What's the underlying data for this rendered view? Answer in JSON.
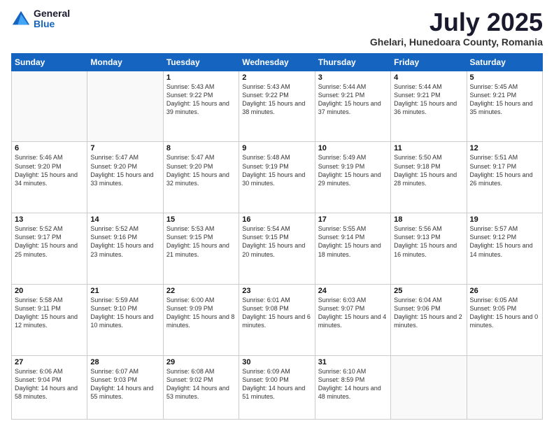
{
  "logo": {
    "general": "General",
    "blue": "Blue"
  },
  "title": "July 2025",
  "subtitle": "Ghelari, Hunedoara County, Romania",
  "weekdays": [
    "Sunday",
    "Monday",
    "Tuesday",
    "Wednesday",
    "Thursday",
    "Friday",
    "Saturday"
  ],
  "weeks": [
    [
      {
        "day": "",
        "sunrise": "",
        "sunset": "",
        "daylight": ""
      },
      {
        "day": "",
        "sunrise": "",
        "sunset": "",
        "daylight": ""
      },
      {
        "day": "1",
        "sunrise": "Sunrise: 5:43 AM",
        "sunset": "Sunset: 9:22 PM",
        "daylight": "Daylight: 15 hours and 39 minutes."
      },
      {
        "day": "2",
        "sunrise": "Sunrise: 5:43 AM",
        "sunset": "Sunset: 9:22 PM",
        "daylight": "Daylight: 15 hours and 38 minutes."
      },
      {
        "day": "3",
        "sunrise": "Sunrise: 5:44 AM",
        "sunset": "Sunset: 9:21 PM",
        "daylight": "Daylight: 15 hours and 37 minutes."
      },
      {
        "day": "4",
        "sunrise": "Sunrise: 5:44 AM",
        "sunset": "Sunset: 9:21 PM",
        "daylight": "Daylight: 15 hours and 36 minutes."
      },
      {
        "day": "5",
        "sunrise": "Sunrise: 5:45 AM",
        "sunset": "Sunset: 9:21 PM",
        "daylight": "Daylight: 15 hours and 35 minutes."
      }
    ],
    [
      {
        "day": "6",
        "sunrise": "Sunrise: 5:46 AM",
        "sunset": "Sunset: 9:20 PM",
        "daylight": "Daylight: 15 hours and 34 minutes."
      },
      {
        "day": "7",
        "sunrise": "Sunrise: 5:47 AM",
        "sunset": "Sunset: 9:20 PM",
        "daylight": "Daylight: 15 hours and 33 minutes."
      },
      {
        "day": "8",
        "sunrise": "Sunrise: 5:47 AM",
        "sunset": "Sunset: 9:20 PM",
        "daylight": "Daylight: 15 hours and 32 minutes."
      },
      {
        "day": "9",
        "sunrise": "Sunrise: 5:48 AM",
        "sunset": "Sunset: 9:19 PM",
        "daylight": "Daylight: 15 hours and 30 minutes."
      },
      {
        "day": "10",
        "sunrise": "Sunrise: 5:49 AM",
        "sunset": "Sunset: 9:19 PM",
        "daylight": "Daylight: 15 hours and 29 minutes."
      },
      {
        "day": "11",
        "sunrise": "Sunrise: 5:50 AM",
        "sunset": "Sunset: 9:18 PM",
        "daylight": "Daylight: 15 hours and 28 minutes."
      },
      {
        "day": "12",
        "sunrise": "Sunrise: 5:51 AM",
        "sunset": "Sunset: 9:17 PM",
        "daylight": "Daylight: 15 hours and 26 minutes."
      }
    ],
    [
      {
        "day": "13",
        "sunrise": "Sunrise: 5:52 AM",
        "sunset": "Sunset: 9:17 PM",
        "daylight": "Daylight: 15 hours and 25 minutes."
      },
      {
        "day": "14",
        "sunrise": "Sunrise: 5:52 AM",
        "sunset": "Sunset: 9:16 PM",
        "daylight": "Daylight: 15 hours and 23 minutes."
      },
      {
        "day": "15",
        "sunrise": "Sunrise: 5:53 AM",
        "sunset": "Sunset: 9:15 PM",
        "daylight": "Daylight: 15 hours and 21 minutes."
      },
      {
        "day": "16",
        "sunrise": "Sunrise: 5:54 AM",
        "sunset": "Sunset: 9:15 PM",
        "daylight": "Daylight: 15 hours and 20 minutes."
      },
      {
        "day": "17",
        "sunrise": "Sunrise: 5:55 AM",
        "sunset": "Sunset: 9:14 PM",
        "daylight": "Daylight: 15 hours and 18 minutes."
      },
      {
        "day": "18",
        "sunrise": "Sunrise: 5:56 AM",
        "sunset": "Sunset: 9:13 PM",
        "daylight": "Daylight: 15 hours and 16 minutes."
      },
      {
        "day": "19",
        "sunrise": "Sunrise: 5:57 AM",
        "sunset": "Sunset: 9:12 PM",
        "daylight": "Daylight: 15 hours and 14 minutes."
      }
    ],
    [
      {
        "day": "20",
        "sunrise": "Sunrise: 5:58 AM",
        "sunset": "Sunset: 9:11 PM",
        "daylight": "Daylight: 15 hours and 12 minutes."
      },
      {
        "day": "21",
        "sunrise": "Sunrise: 5:59 AM",
        "sunset": "Sunset: 9:10 PM",
        "daylight": "Daylight: 15 hours and 10 minutes."
      },
      {
        "day": "22",
        "sunrise": "Sunrise: 6:00 AM",
        "sunset": "Sunset: 9:09 PM",
        "daylight": "Daylight: 15 hours and 8 minutes."
      },
      {
        "day": "23",
        "sunrise": "Sunrise: 6:01 AM",
        "sunset": "Sunset: 9:08 PM",
        "daylight": "Daylight: 15 hours and 6 minutes."
      },
      {
        "day": "24",
        "sunrise": "Sunrise: 6:03 AM",
        "sunset": "Sunset: 9:07 PM",
        "daylight": "Daylight: 15 hours and 4 minutes."
      },
      {
        "day": "25",
        "sunrise": "Sunrise: 6:04 AM",
        "sunset": "Sunset: 9:06 PM",
        "daylight": "Daylight: 15 hours and 2 minutes."
      },
      {
        "day": "26",
        "sunrise": "Sunrise: 6:05 AM",
        "sunset": "Sunset: 9:05 PM",
        "daylight": "Daylight: 15 hours and 0 minutes."
      }
    ],
    [
      {
        "day": "27",
        "sunrise": "Sunrise: 6:06 AM",
        "sunset": "Sunset: 9:04 PM",
        "daylight": "Daylight: 14 hours and 58 minutes."
      },
      {
        "day": "28",
        "sunrise": "Sunrise: 6:07 AM",
        "sunset": "Sunset: 9:03 PM",
        "daylight": "Daylight: 14 hours and 55 minutes."
      },
      {
        "day": "29",
        "sunrise": "Sunrise: 6:08 AM",
        "sunset": "Sunset: 9:02 PM",
        "daylight": "Daylight: 14 hours and 53 minutes."
      },
      {
        "day": "30",
        "sunrise": "Sunrise: 6:09 AM",
        "sunset": "Sunset: 9:00 PM",
        "daylight": "Daylight: 14 hours and 51 minutes."
      },
      {
        "day": "31",
        "sunrise": "Sunrise: 6:10 AM",
        "sunset": "Sunset: 8:59 PM",
        "daylight": "Daylight: 14 hours and 48 minutes."
      },
      {
        "day": "",
        "sunrise": "",
        "sunset": "",
        "daylight": ""
      },
      {
        "day": "",
        "sunrise": "",
        "sunset": "",
        "daylight": ""
      }
    ]
  ]
}
